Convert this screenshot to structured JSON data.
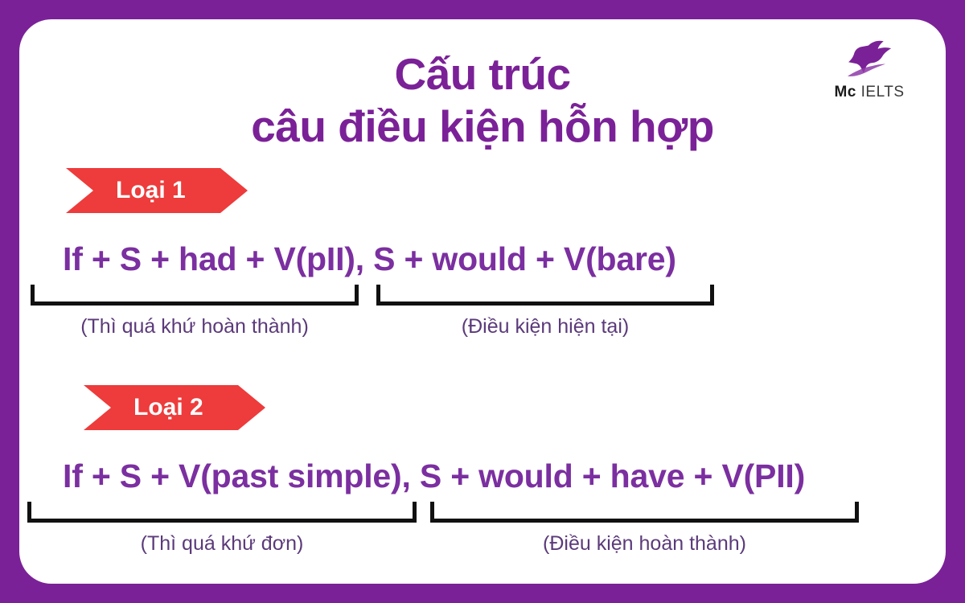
{
  "colors": {
    "frame_purple": "#7B2198",
    "card_white": "#FFFFFF",
    "title_purple": "#7B2198",
    "formula_purple": "#7B2FA0",
    "caption_purple": "#5B3A7A",
    "ribbon_red": "#EE3B3B",
    "bracket_black": "#111111"
  },
  "logo": {
    "icon": "hummingbird-icon",
    "brand_mc": "Mc",
    "brand_ielts": "IELTS"
  },
  "title": {
    "line1": "Cấu trúc",
    "line2": "câu điều kiện hỗn hợp"
  },
  "sections": [
    {
      "ribbon_label": "Loại 1",
      "formula": "If + S + had + V(pII), S + would + V(bare)",
      "caption_left": "(Thì quá khứ hoàn thành)",
      "caption_right": "(Điều kiện hiện tại)"
    },
    {
      "ribbon_label": "Loại 2",
      "formula": "If + S + V(past simple), S + would + have + V(PII)",
      "caption_left": "(Thì quá khứ đơn)",
      "caption_right": "(Điều kiện hoàn thành)"
    }
  ]
}
